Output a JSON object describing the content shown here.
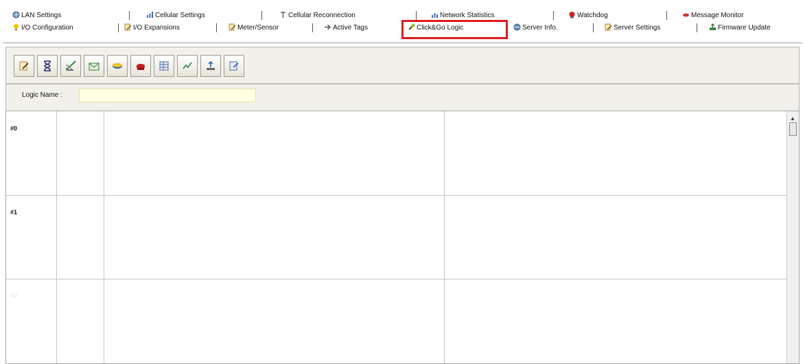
{
  "tabs": {
    "row1": [
      {
        "label": "LAN Settings",
        "icon": "lan-icon"
      },
      {
        "label": "Cellular Settings",
        "icon": "cellular-icon"
      },
      {
        "label": "Cellular Reconnection",
        "icon": "antenna-icon"
      },
      {
        "label": "Network Statistics",
        "icon": "network-stats-icon"
      },
      {
        "label": "Watchdog",
        "icon": "watchdog-icon"
      },
      {
        "label": "Message Monitor",
        "icon": "message-icon"
      }
    ],
    "row2": [
      {
        "label": "I/O Configuration",
        "icon": "lightbulb-icon"
      },
      {
        "label": "I/O Expansions",
        "icon": "edit-icon"
      },
      {
        "label": "Meter/Sensor",
        "icon": "edit-icon"
      },
      {
        "label": "Active Tags",
        "icon": "tags-icon"
      },
      {
        "label": "Click&Go Logic",
        "icon": "logic-icon",
        "active": true
      },
      {
        "label": "Server Info.",
        "icon": "server-icon"
      },
      {
        "label": "Server Settings",
        "icon": "edit-icon"
      },
      {
        "label": "Firmware Update",
        "icon": "firmware-icon"
      }
    ]
  },
  "toolbar": {
    "buttons": [
      "edit-icon",
      "hourglass-icon",
      "satellite-icon",
      "envelope-icon",
      "disk-icon",
      "telephone-icon",
      "table-icon",
      "graph-icon",
      "upload-icon",
      "export-icon"
    ]
  },
  "logic": {
    "name_label": "Logic Name :",
    "name_value": ""
  },
  "grid": {
    "rows": [
      "#0",
      "#1",
      "#2"
    ]
  },
  "colors": {
    "highlight": "#e0191b",
    "input_background": "#ffffe1",
    "panel_background": "#f1f0ea"
  }
}
